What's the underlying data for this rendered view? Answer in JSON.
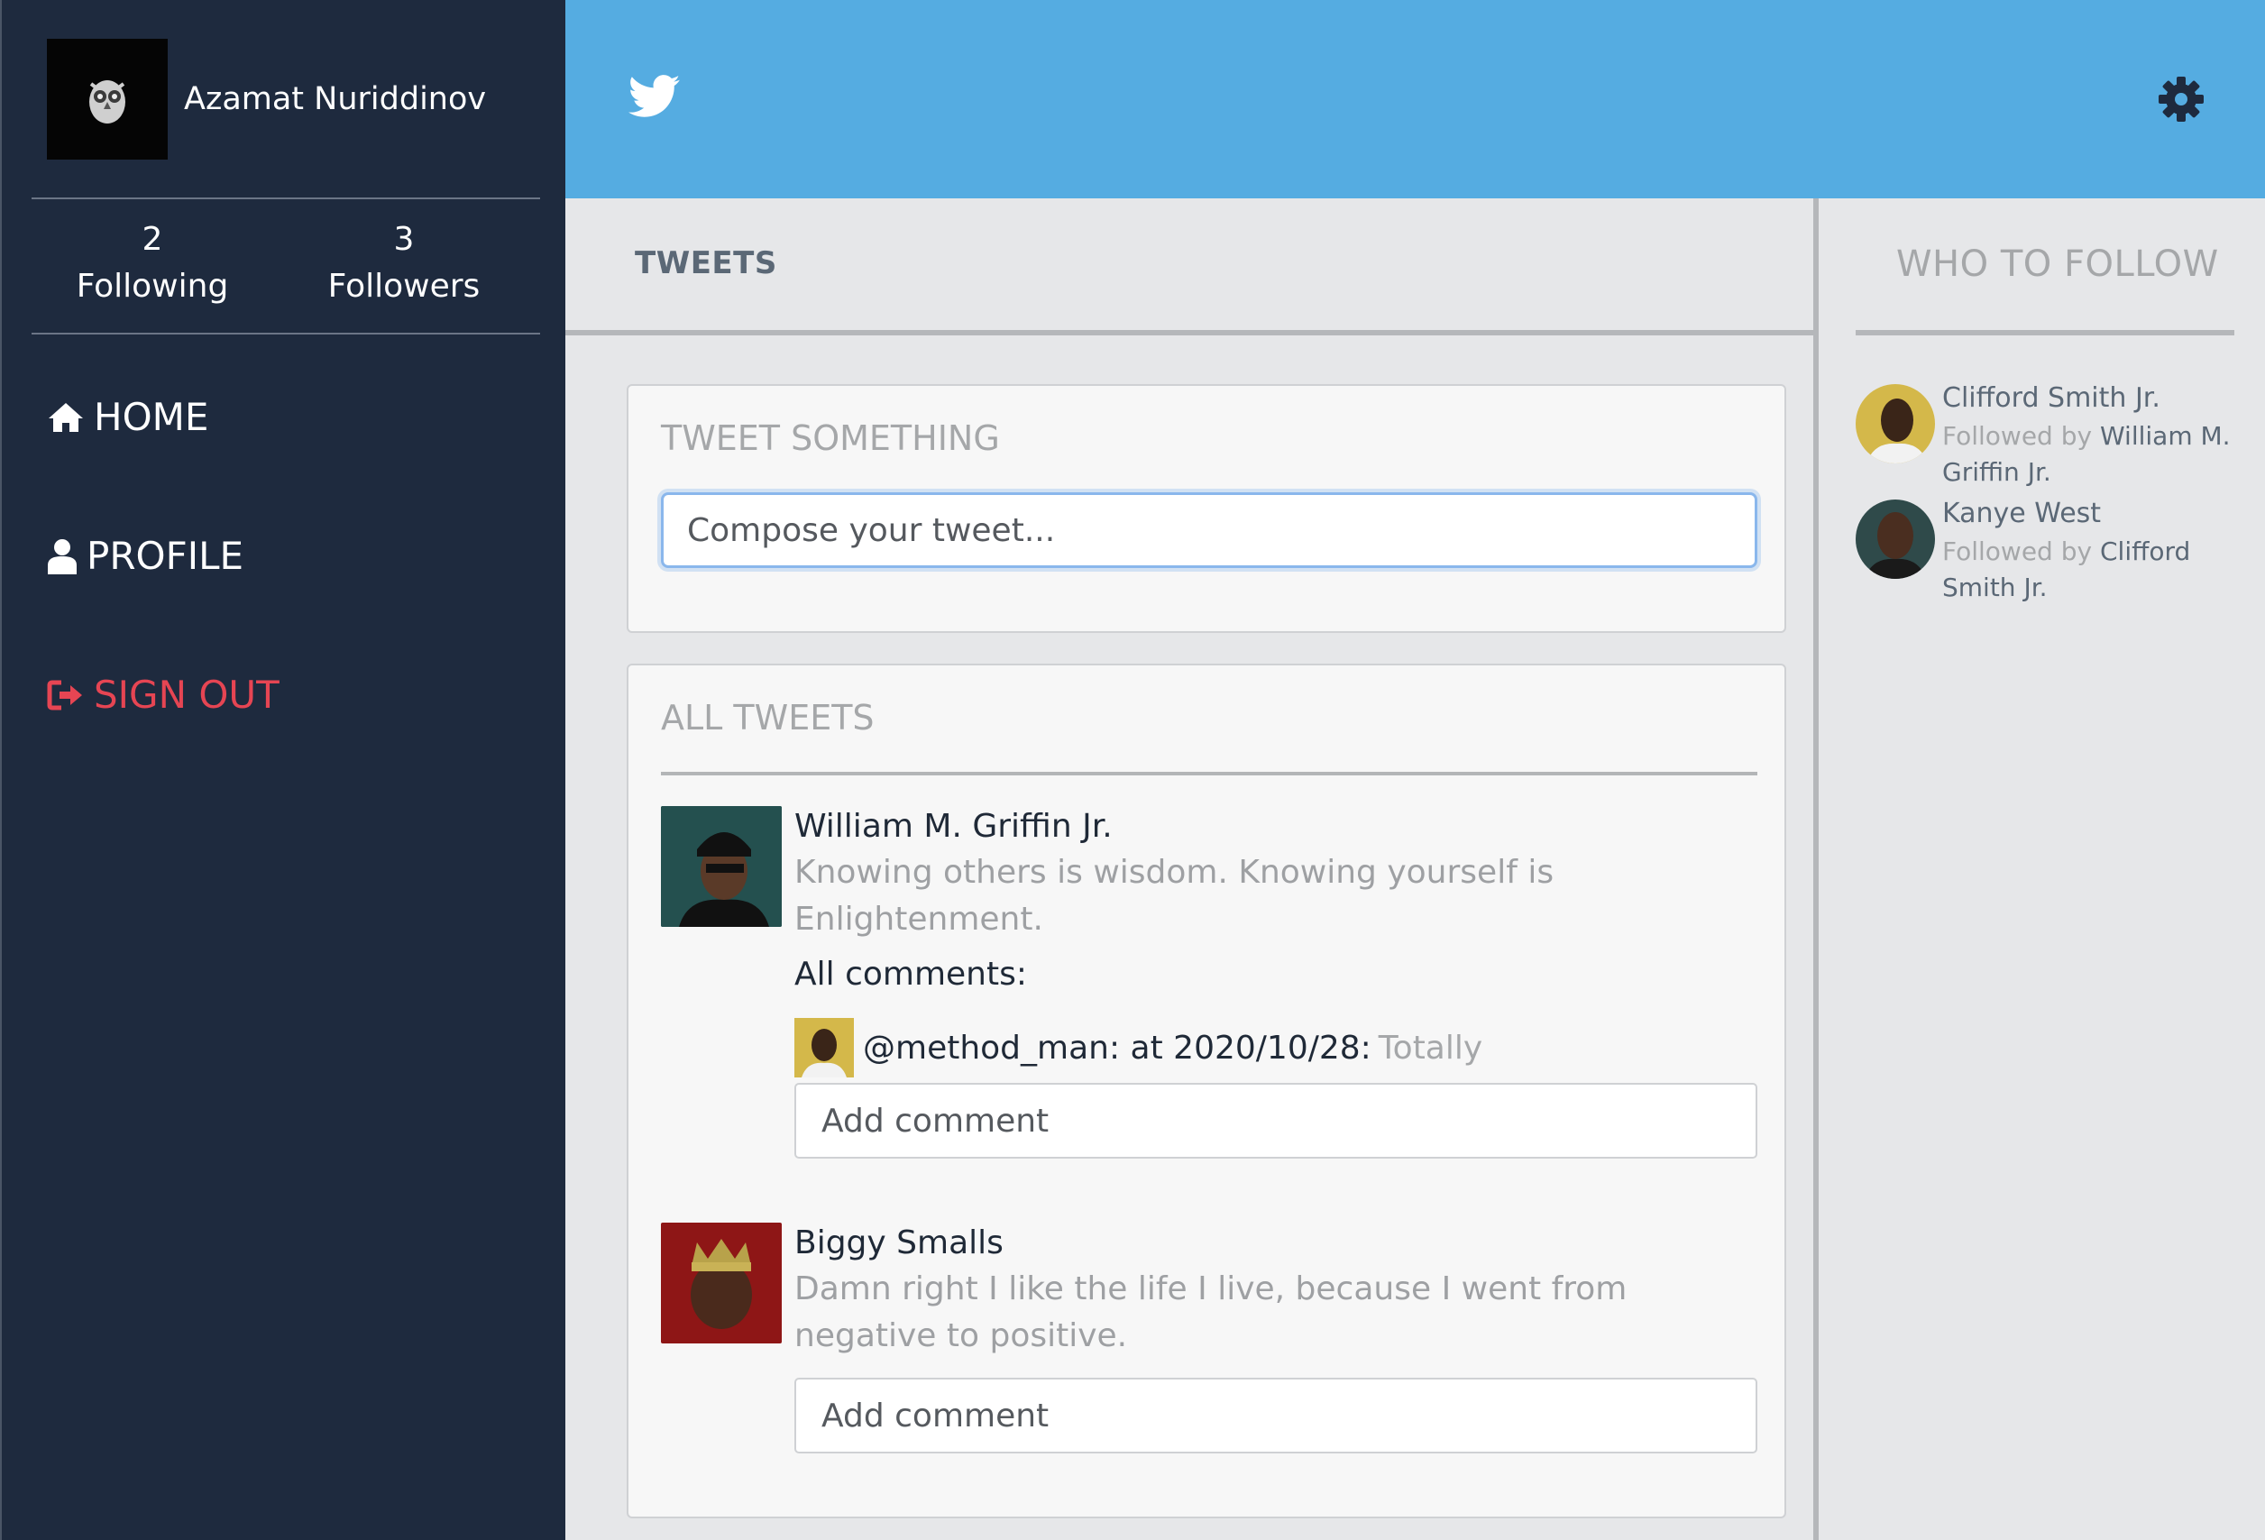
{
  "sidebar": {
    "user_name": "Azamat Nuriddinov",
    "stats": [
      {
        "count": "2",
        "label": "Following"
      },
      {
        "count": "3",
        "label": "Followers"
      }
    ],
    "nav": {
      "home": "HOME",
      "profile": "PROFILE",
      "signout": "SIGN OUT"
    }
  },
  "header": {
    "logo_icon": "twitter-bird-icon",
    "settings_icon": "gear-icon"
  },
  "tweets": {
    "title": "TWEETS",
    "compose": {
      "title": "TWEET SOMETHING",
      "placeholder": "Compose your tweet..."
    },
    "all": {
      "title": "ALL TWEETS",
      "items": [
        {
          "author": "William M. Griffin Jr.",
          "text": "Knowing others is wisdom. Knowing yourself is Enlightenment.",
          "comments_label": "All comments:",
          "comments": [
            {
              "meta": "@method_man: at 2020/10/28:",
              "text": "Totally"
            }
          ],
          "comment_placeholder": "Add comment"
        },
        {
          "author": "Biggy Smalls",
          "text": "Damn right I like the life I live, because I went from negative to positive.",
          "comment_placeholder": "Add comment"
        }
      ]
    }
  },
  "who_to_follow": {
    "title": "WHO TO FOLLOW",
    "followed_by_label": "Followed by",
    "items": [
      {
        "name": "Clifford Smith Jr.",
        "followed_by": "William M. Griffin Jr."
      },
      {
        "name": "Kanye West",
        "followed_by": "Clifford Smith Jr."
      }
    ]
  },
  "colors": {
    "sidebar_bg": "#1e2a3e",
    "header_bg": "#55ace1",
    "signout": "#e64553",
    "content_bg": "#e6e7e9"
  }
}
